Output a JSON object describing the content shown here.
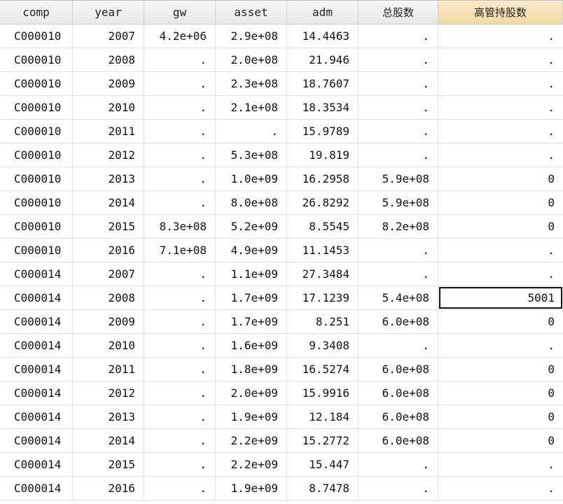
{
  "columns": [
    "comp",
    "year",
    "gw",
    "asset",
    "adm",
    "总股数",
    "高管持股数"
  ],
  "rows": [
    [
      "C000010",
      "2007",
      "4.2e+06",
      "2.9e+08",
      "14.4463",
      ".",
      "."
    ],
    [
      "C000010",
      "2008",
      ".",
      "2.0e+08",
      "21.946",
      ".",
      "."
    ],
    [
      "C000010",
      "2009",
      ".",
      "2.3e+08",
      "18.7607",
      ".",
      "."
    ],
    [
      "C000010",
      "2010",
      ".",
      "2.1e+08",
      "18.3534",
      ".",
      "."
    ],
    [
      "C000010",
      "2011",
      ".",
      ".",
      "15.9789",
      ".",
      "."
    ],
    [
      "C000010",
      "2012",
      ".",
      "5.3e+08",
      "19.819",
      ".",
      "."
    ],
    [
      "C000010",
      "2013",
      ".",
      "1.0e+09",
      "16.2958",
      "5.9e+08",
      "0"
    ],
    [
      "C000010",
      "2014",
      ".",
      "8.0e+08",
      "26.8292",
      "5.9e+08",
      "0"
    ],
    [
      "C000010",
      "2015",
      "8.3e+08",
      "5.2e+09",
      "8.5545",
      "8.2e+08",
      "0"
    ],
    [
      "C000010",
      "2016",
      "7.1e+08",
      "4.9e+09",
      "11.1453",
      ".",
      "."
    ],
    [
      "C000014",
      "2007",
      ".",
      "1.1e+09",
      "27.3484",
      ".",
      "."
    ],
    [
      "C000014",
      "2008",
      ".",
      "1.7e+09",
      "17.1239",
      "5.4e+08",
      "5001"
    ],
    [
      "C000014",
      "2009",
      ".",
      "1.7e+09",
      "8.251",
      "6.0e+08",
      "0"
    ],
    [
      "C000014",
      "2010",
      ".",
      "1.6e+09",
      "9.3408",
      ".",
      "."
    ],
    [
      "C000014",
      "2011",
      ".",
      "1.8e+09",
      "16.5274",
      "6.0e+08",
      "0"
    ],
    [
      "C000014",
      "2012",
      ".",
      "2.0e+09",
      "15.9916",
      "6.0e+08",
      "0"
    ],
    [
      "C000014",
      "2013",
      ".",
      "1.9e+09",
      "12.184",
      "6.0e+08",
      "0"
    ],
    [
      "C000014",
      "2014",
      ".",
      "2.2e+09",
      "15.2772",
      "6.0e+08",
      "0"
    ],
    [
      "C000014",
      "2015",
      ".",
      "2.2e+09",
      "15.447",
      ".",
      "."
    ],
    [
      "C000014",
      "2016",
      ".",
      "1.9e+09",
      "8.7478",
      ".",
      "."
    ]
  ],
  "selected_column_index": 6,
  "active_cell": {
    "row": 11,
    "column": 6
  },
  "colors": {
    "header_background": "#eeeeee",
    "selected_header_background": "#f6dfb2",
    "gridline": "#e2e2e2",
    "active_cell_border": "#111111"
  }
}
